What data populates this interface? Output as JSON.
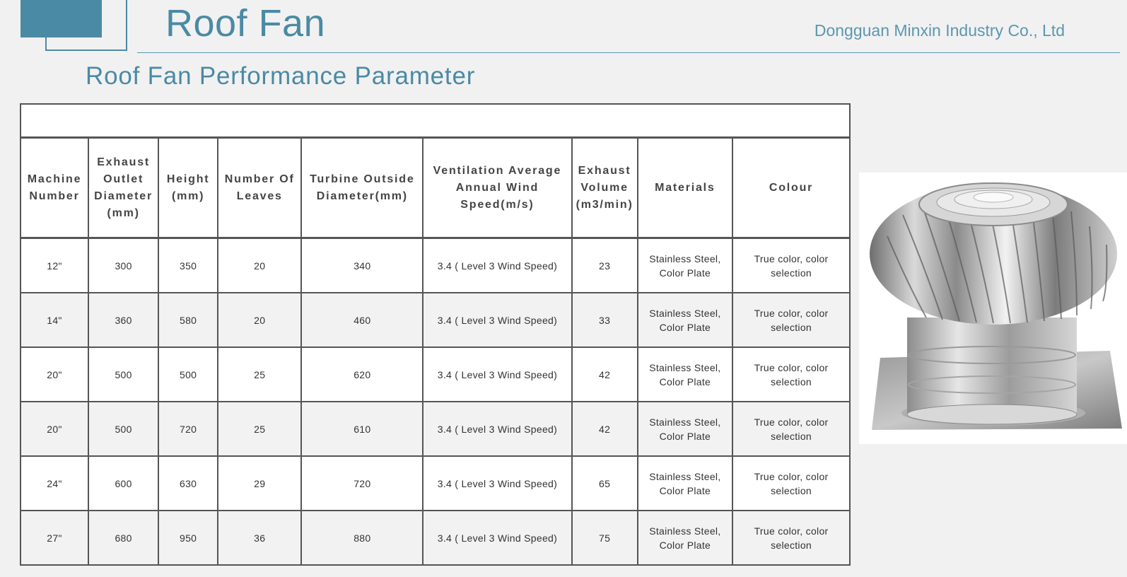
{
  "header": {
    "title": "Roof Fan",
    "company": "Dongguan Minxin Industry Co., Ltd"
  },
  "subtitle": "Roof Fan Performance Parameter",
  "colors": {
    "accent": "#4a8aa4",
    "border": "#555555"
  },
  "table": {
    "columns": [
      "Machine Number",
      "Exhaust Outlet Diameter (mm)",
      "Height (mm)",
      "Number Of Leaves",
      "Turbine Outside Diameter(mm)",
      "Ventilation Average Annual Wind Speed(m/s)",
      "Exhaust Volume (m3/min)",
      "Materials",
      "Colour"
    ],
    "rows": [
      [
        "12\"",
        "300",
        "350",
        "20",
        "340",
        "3.4 ( Level 3 Wind Speed)",
        "23",
        "Stainless Steel, Color Plate",
        "True color, color selection"
      ],
      [
        "14\"",
        "360",
        "580",
        "20",
        "460",
        "3.4 ( Level 3 Wind Speed)",
        "33",
        "Stainless Steel, Color Plate",
        "True color, color selection"
      ],
      [
        "20\"",
        "500",
        "500",
        "25",
        "620",
        "3.4 ( Level 3 Wind Speed)",
        "42",
        "Stainless Steel, Color Plate",
        "True color, color selection"
      ],
      [
        "20\"",
        "500",
        "720",
        "25",
        "610",
        "3.4 ( Level 3 Wind Speed)",
        "42",
        "Stainless Steel, Color Plate",
        "True color, color selection"
      ],
      [
        "24\"",
        "600",
        "630",
        "29",
        "720",
        "3.4 ( Level 3 Wind Speed)",
        "65",
        "Stainless Steel, Color Plate",
        "True color, color selection"
      ],
      [
        "27\"",
        "680",
        "950",
        "36",
        "880",
        "3.4 ( Level 3 Wind Speed)",
        "75",
        "Stainless Steel, Color Plate",
        "True color, color selection"
      ]
    ]
  },
  "image": {
    "icon": "roof-turbine-fan-photo"
  }
}
